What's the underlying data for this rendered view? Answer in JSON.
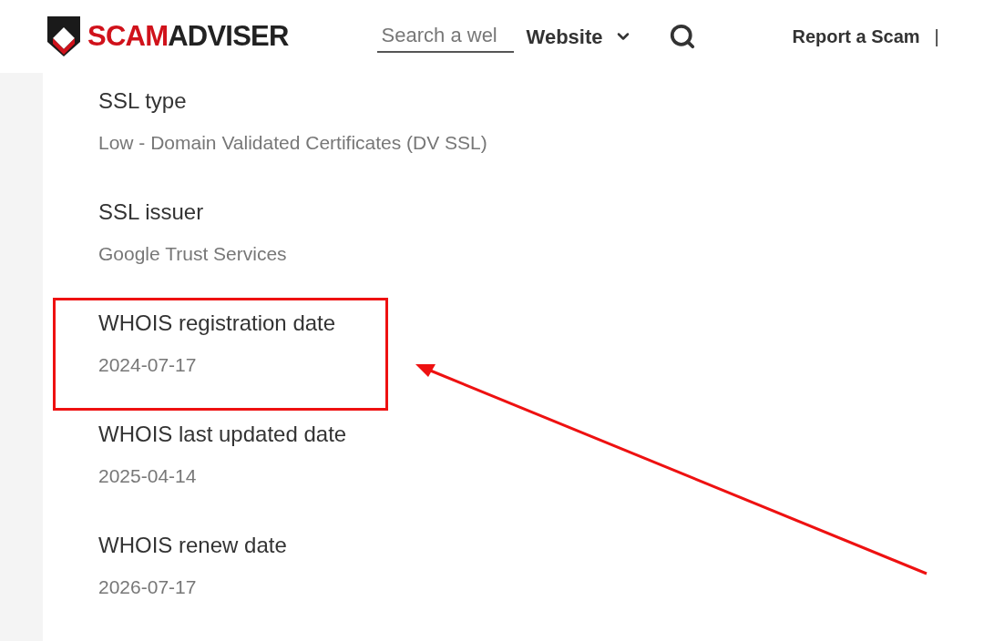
{
  "header": {
    "logo": {
      "accent": "SCAM",
      "rest": "ADVISER"
    },
    "search": {
      "placeholder": "Search a wel"
    },
    "search_type": "Website",
    "nav": [
      "Report a Scam"
    ],
    "separator": "|"
  },
  "details": [
    {
      "label": "SSL type",
      "value": "Low - Domain Validated Certificates (DV SSL)",
      "highlighted": false
    },
    {
      "label": "SSL issuer",
      "value": "Google Trust Services",
      "highlighted": false
    },
    {
      "label": "WHOIS registration date",
      "value": "2024-07-17",
      "highlighted": true
    },
    {
      "label": "WHOIS last updated date",
      "value": "2025-04-14",
      "highlighted": false
    },
    {
      "label": "WHOIS renew date",
      "value": "2026-07-17",
      "highlighted": false
    }
  ]
}
